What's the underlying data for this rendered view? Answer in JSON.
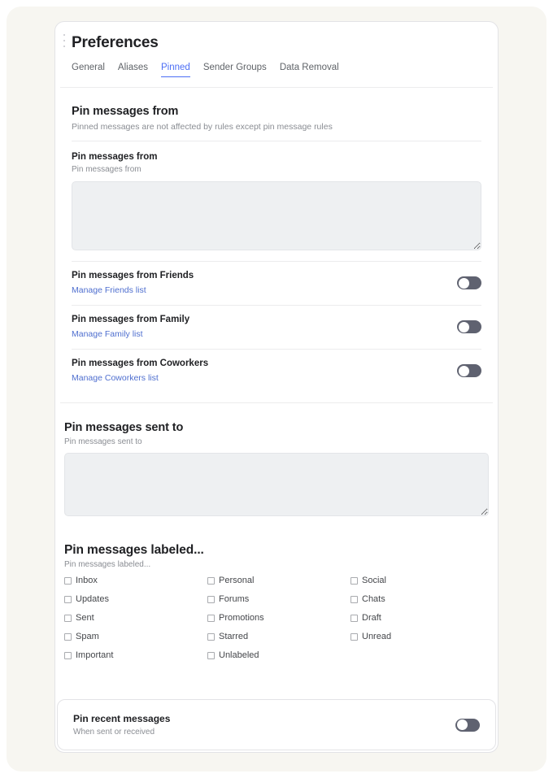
{
  "window": {
    "title": "Preferences",
    "drag_handle_icon": "drag-dots-icon"
  },
  "tabs": [
    {
      "label": "General",
      "active": false
    },
    {
      "label": "Aliases",
      "active": false
    },
    {
      "label": "Pinned",
      "active": true
    },
    {
      "label": "Sender Groups",
      "active": false
    },
    {
      "label": "Data Removal",
      "active": false
    }
  ],
  "colors": {
    "accent": "#4c6ef5",
    "link": "#4f6fcf",
    "toggle_off_track": "#5f6270",
    "toggle_knob": "#ffffff",
    "page_background": "#f7f6f1",
    "card_background": "#ffffff",
    "field_background": "#eef0f2",
    "muted_text": "#8a8d93",
    "heading_text": "#202124"
  },
  "sections": {
    "pin_from": {
      "title": "Pin messages from",
      "subtitle": "Pinned messages are not affected by rules except pin message rules",
      "field": {
        "label": "Pin messages from",
        "hint": "Pin messages from",
        "value": "",
        "placeholder": ""
      },
      "toggle_rows": [
        {
          "title": "Pin messages from Friends",
          "link": "Manage Friends list",
          "enabled": false
        },
        {
          "title": "Pin messages from Family",
          "link": "Manage Family list",
          "enabled": false
        },
        {
          "title": "Pin messages from Coworkers",
          "link": "Manage Coworkers list",
          "enabled": false
        }
      ]
    },
    "pin_sent_to": {
      "title": "Pin messages sent to",
      "hint": "Pin messages sent to",
      "value": "",
      "placeholder": ""
    },
    "pin_labeled": {
      "title": "Pin messages labeled...",
      "hint": "Pin messages labeled...",
      "checkboxes": [
        {
          "label": "Inbox",
          "checked": false
        },
        {
          "label": "Personal",
          "checked": false
        },
        {
          "label": "Social",
          "checked": false
        },
        {
          "label": "Updates",
          "checked": false
        },
        {
          "label": "Forums",
          "checked": false
        },
        {
          "label": "Chats",
          "checked": false
        },
        {
          "label": "Sent",
          "checked": false
        },
        {
          "label": "Promotions",
          "checked": false
        },
        {
          "label": "Draft",
          "checked": false
        },
        {
          "label": "Spam",
          "checked": false
        },
        {
          "label": "Starred",
          "checked": false
        },
        {
          "label": "Unread",
          "checked": false
        },
        {
          "label": "Important",
          "checked": false
        },
        {
          "label": "Unlabeled",
          "checked": false
        },
        {
          "label": "",
          "checked": false
        }
      ]
    },
    "pin_recent": {
      "title": "Pin recent messages",
      "subtitle": "When sent or received",
      "enabled": false
    }
  }
}
